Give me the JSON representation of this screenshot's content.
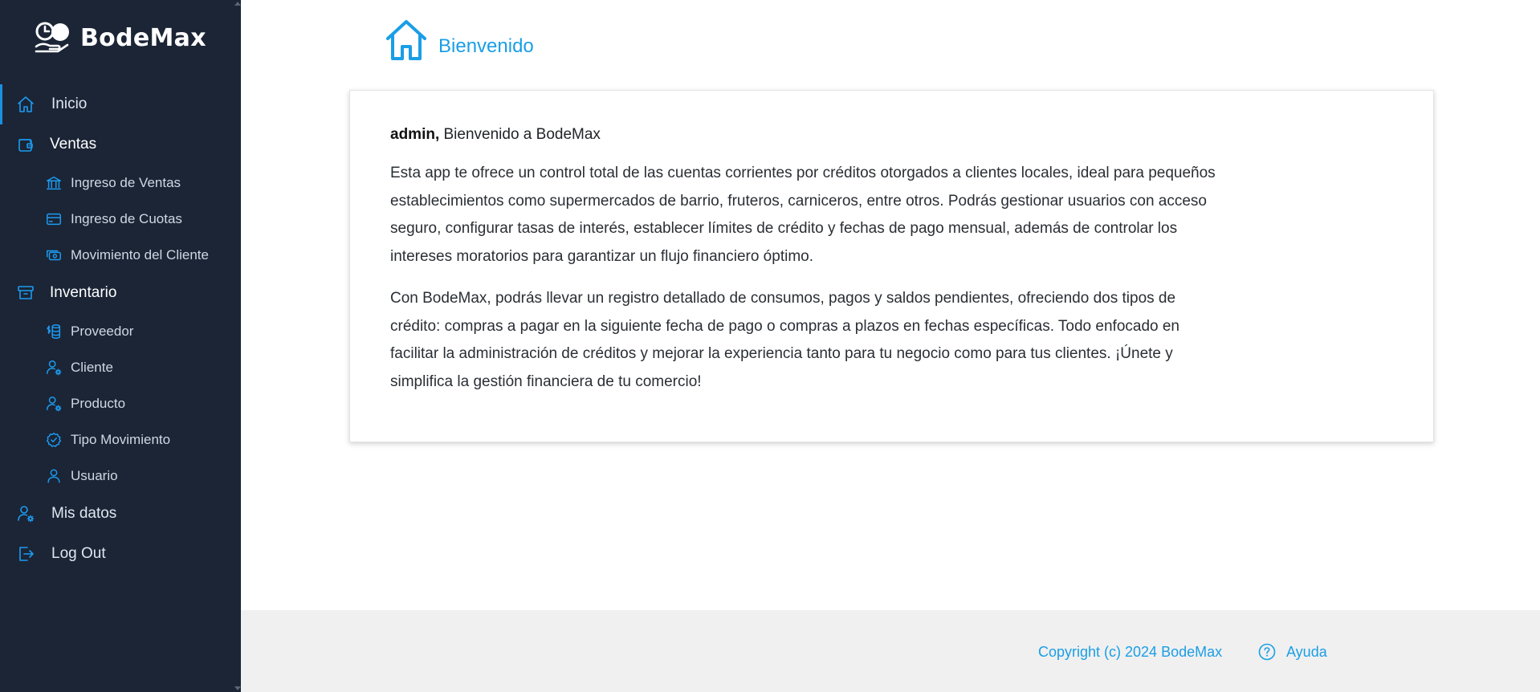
{
  "brand": {
    "name": "BodeMax",
    "logo_icon": "clock-coin-hand-icon"
  },
  "sidebar": {
    "items": [
      {
        "label": "Inicio",
        "icon": "home-icon",
        "active": true
      },
      {
        "label": "Ventas",
        "icon": "wallet-icon",
        "group": true,
        "children": [
          {
            "label": "Ingreso de Ventas",
            "icon": "bank-icon"
          },
          {
            "label": "Ingreso de Cuotas",
            "icon": "credit-card-icon"
          },
          {
            "label": "Movimiento del Cliente",
            "icon": "cash-stack-icon"
          }
        ]
      },
      {
        "label": "Inventario",
        "icon": "archive-box-icon",
        "group": true,
        "children": [
          {
            "label": "Proveedor",
            "icon": "coins-dollar-icon"
          },
          {
            "label": "Cliente",
            "icon": "user-gear-icon"
          },
          {
            "label": "Producto",
            "icon": "user-gear-icon"
          },
          {
            "label": "Tipo Movimiento",
            "icon": "check-badge-icon"
          },
          {
            "label": "Usuario",
            "icon": "user-icon"
          }
        ]
      },
      {
        "label": "Mis datos",
        "icon": "user-gear-icon"
      },
      {
        "label": "Log Out",
        "icon": "logout-icon"
      }
    ]
  },
  "header": {
    "title": "Bienvenido",
    "icon": "home-icon"
  },
  "card": {
    "user": "admin,",
    "greeting": " Bienvenido a BodeMax",
    "paragraph1": "Esta app te ofrece un control total de las cuentas corrientes por créditos otorgados a clientes locales, ideal para pequeños establecimientos como supermercados de barrio, fruteros, carniceros, entre otros. Podrás gestionar usuarios con acceso seguro, configurar tasas de interés, establecer límites de crédito y fechas de pago mensual, además de controlar los intereses moratorios para garantizar un flujo financiero óptimo.",
    "paragraph2": "Con BodeMax, podrás llevar un registro detallado de consumos, pagos y saldos pendientes, ofreciendo dos tipos de crédito: compras a pagar en la siguiente fecha de pago o compras a plazos en fechas específicas. Todo enfocado en facilitar la administración de créditos y mejorar la experiencia tanto para tu negocio como para tus clientes. ¡Únete y simplifica la gestión financiera de tu comercio!"
  },
  "footer": {
    "copyright": "Copyright (c) 2024 BodeMax",
    "help_label": "Ayuda",
    "help_icon": "question-circle-icon"
  },
  "colors": {
    "sidebar_bg": "#1b2536",
    "accent": "#1a9ee6",
    "footer_bg": "#f0f0f0"
  }
}
